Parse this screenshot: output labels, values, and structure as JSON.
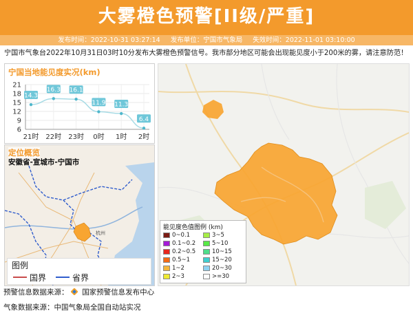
{
  "header": {
    "title": "大雾橙色预警[II级/严重]",
    "publish_time": "发布时间：2022-10-31 03:27:14",
    "publisher": "发布单位：宁国市气象局",
    "expire_time": "失效时间：2022-11-01 03:10:00"
  },
  "notice": "宁国市气象台2022年10月31日03时10分发布大雾橙色预警信号。我市部分地区可能会出现能见度小于200米的雾，请注意防范！",
  "visibility_panel": {
    "title": "宁国当地能见度实况(km)"
  },
  "chart_data": {
    "type": "line",
    "title": "宁国当地能见度实况(km)",
    "categories": [
      "21时",
      "22时",
      "23时",
      "0时",
      "1时",
      "2时"
    ],
    "values": [
      14.3,
      16.3,
      16.1,
      11.9,
      11.3,
      6.4
    ],
    "yticks": [
      21,
      18,
      15,
      12,
      9,
      6
    ],
    "ylim": [
      6,
      21
    ],
    "grid": true,
    "color": "#6fc7d9"
  },
  "location_panel": {
    "title": "定位概览",
    "location": "安徽省-宣城市-宁国市"
  },
  "boundary_legend": {
    "title": "图例",
    "national": "国界",
    "provincial": "省界"
  },
  "map_city_label": "杭州",
  "visibility_legend": {
    "title": "能见度色值图例 (km)",
    "items": [
      {
        "label": "0~0.1",
        "color": "#7a1b14"
      },
      {
        "label": "3~5",
        "color": "#a6ee46"
      },
      {
        "label": "0.1~0.2",
        "color": "#a51bd8"
      },
      {
        "label": "5~10",
        "color": "#58ea46"
      },
      {
        "label": "0.2~0.5",
        "color": "#e8261e"
      },
      {
        "label": "10~15",
        "color": "#4fde8a"
      },
      {
        "label": "0.5~1",
        "color": "#f56a14"
      },
      {
        "label": "15~20",
        "color": "#3fd0d0"
      },
      {
        "label": "1~2",
        "color": "#f4b63b"
      },
      {
        "label": "20~30",
        "color": "#8ed2f2"
      },
      {
        "label": "2~3",
        "color": "#eeea34"
      },
      {
        "label": ">=30",
        "color": "#ffffff"
      }
    ]
  },
  "footer": {
    "warning_source_label": "预警信息数据来源：",
    "warning_source": "国家预警信息发布中心",
    "weather_source": "气象数据来源：中国气象局全国自动站实况"
  },
  "colors": {
    "accent": "#f39a2c",
    "region_fill": "#f8a531"
  }
}
